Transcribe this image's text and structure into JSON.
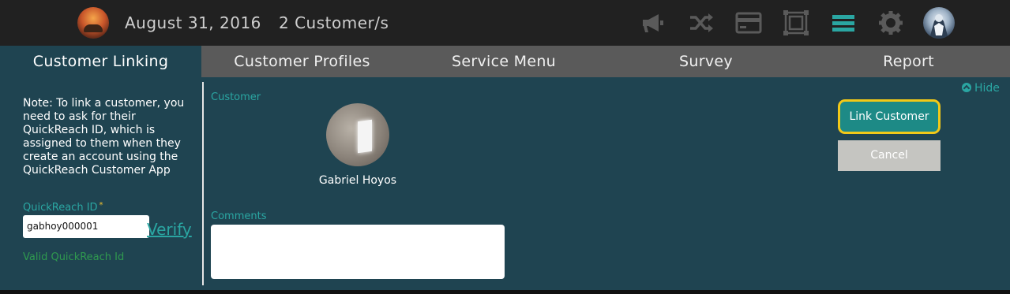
{
  "header": {
    "date": "August 31, 2016",
    "customer_count": "2 Customer/s",
    "icons": [
      "megaphone-icon",
      "shuffle-icon",
      "card-icon",
      "frame-icon",
      "menu-icon",
      "gear-icon",
      "profile-avatar"
    ],
    "colors": {
      "bar": "#212121",
      "icon": "#555555",
      "active_icon": "#2aa6a2"
    }
  },
  "nav": {
    "tabs": [
      "Customer Linking",
      "Customer Profiles",
      "Service Menu",
      "Survey",
      "Report"
    ],
    "active": "Customer Linking"
  },
  "left_panel": {
    "note": "Note: To link a customer, you need to ask for their QuickReach ID, which is assigned to them when they create an account using the QuickReach Customer App",
    "quickreach_label": "QuickReach ID",
    "required_mark": "*",
    "quickreach_value": "gabhoy000001",
    "verify_label": "Verify",
    "valid_message": "Valid QuickReach Id"
  },
  "main": {
    "customer_label": "Customer",
    "customer_name": "Gabriel Hoyos",
    "comments_label": "Comments",
    "comments_value": ""
  },
  "actions": {
    "hide_label": "Hide",
    "link_label": "Link Customer",
    "cancel_label": "Cancel"
  },
  "colors": {
    "content_bg": "#1f4451",
    "accent": "#2aa6a2",
    "highlight": "#f2c918",
    "valid": "#2f9a4f"
  }
}
